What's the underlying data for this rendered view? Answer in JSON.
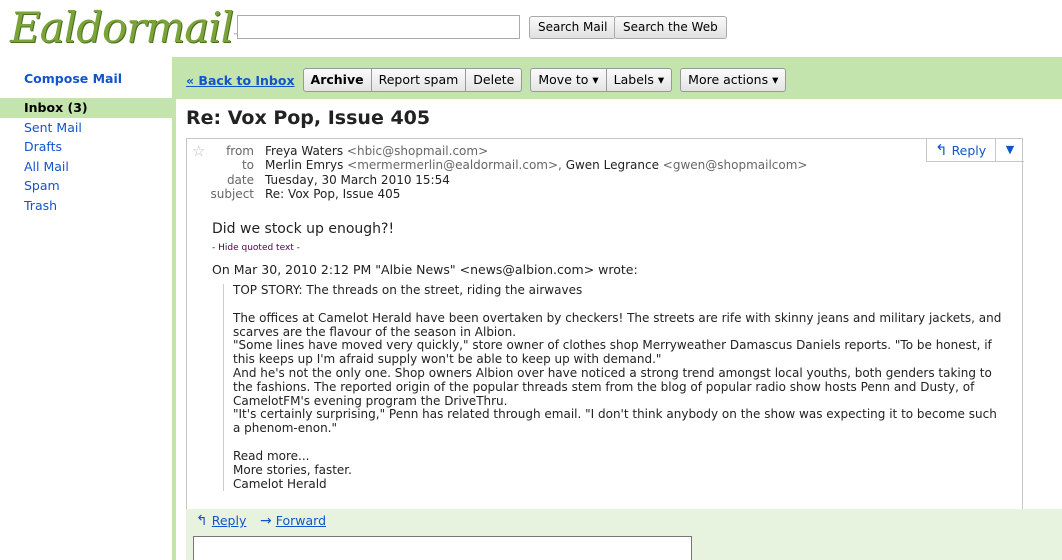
{
  "brand": {
    "logo_text": "Ealdormail",
    "logo_tm": "™"
  },
  "search": {
    "value": "",
    "search_mail_label": "Search Mail",
    "search_web_label": "Search the Web"
  },
  "nav": {
    "compose_label": "Compose Mail",
    "items": [
      {
        "label": "Inbox (3)",
        "active": true
      },
      {
        "label": "Sent Mail"
      },
      {
        "label": "Drafts"
      },
      {
        "label": "All Mail"
      },
      {
        "label": "Spam"
      },
      {
        "label": "Trash"
      }
    ]
  },
  "toolbar": {
    "back_label": "« Back to Inbox",
    "archive_label": "Archive",
    "report_spam_label": "Report spam",
    "delete_label": "Delete",
    "move_to_label": "Move to ▾",
    "labels_label": "Labels ▾",
    "more_actions_label": "More actions ▾"
  },
  "message": {
    "subject": "Re: Vox Pop, Issue 405",
    "from_label": "from",
    "from_name": "Freya Waters",
    "from_addr": "<hbic@shopmail.com>",
    "to_label": "to",
    "to_name1": "Merlin Emrys",
    "to_addr1": "<mermermerlin@ealdormail.com>,",
    "to_name2": "Gwen Legrance",
    "to_addr2": "<gwen@shopmailcom>",
    "date_label": "date",
    "date_value": "Tuesday, 30 March 2010 15:54",
    "subject_label": "subject",
    "subject_value": "Re: Vox Pop, Issue 405",
    "reply_label": "Reply",
    "reply_more": "▼",
    "body_first_line": "Did we stock up enough?!",
    "hide_quoted": "- Hide quoted text -",
    "wrote_line": "On Mar 30, 2010 2:12 PM \"Albie News\" <news@albion.com> wrote:",
    "quoted_paragraphs": [
      "TOP STORY: The threads on the street, riding the airwaves",
      "The offices at Camelot Herald have been overtaken by checkers! The streets are rife with skinny jeans and military jackets, and scarves are the flavour of the season in Albion.\n\"Some lines have moved very quickly,\" store owner of clothes shop Merryweather Damascus Daniels reports. \"To be honest, if this keeps up I'm afraid supply won't be able to keep up with demand.\"\nAnd he's not the only one. Shop owners Albion over have noticed a strong trend amongst local youths, both genders taking to the fashions. The reported origin of the popular threads stem from the blog of popular radio show hosts Penn and Dusty, of CamelotFM's evening program the DriveThru.\n\"It's certainly surprising,\" Penn has related through email. \"I don't think anybody on the show was expecting it to become such a phenom-enon.\"",
      "Read more...\nMore stories, faster.\nCamelot Herald"
    ]
  },
  "footer": {
    "reply_label": "Reply",
    "forward_label": "Forward"
  }
}
